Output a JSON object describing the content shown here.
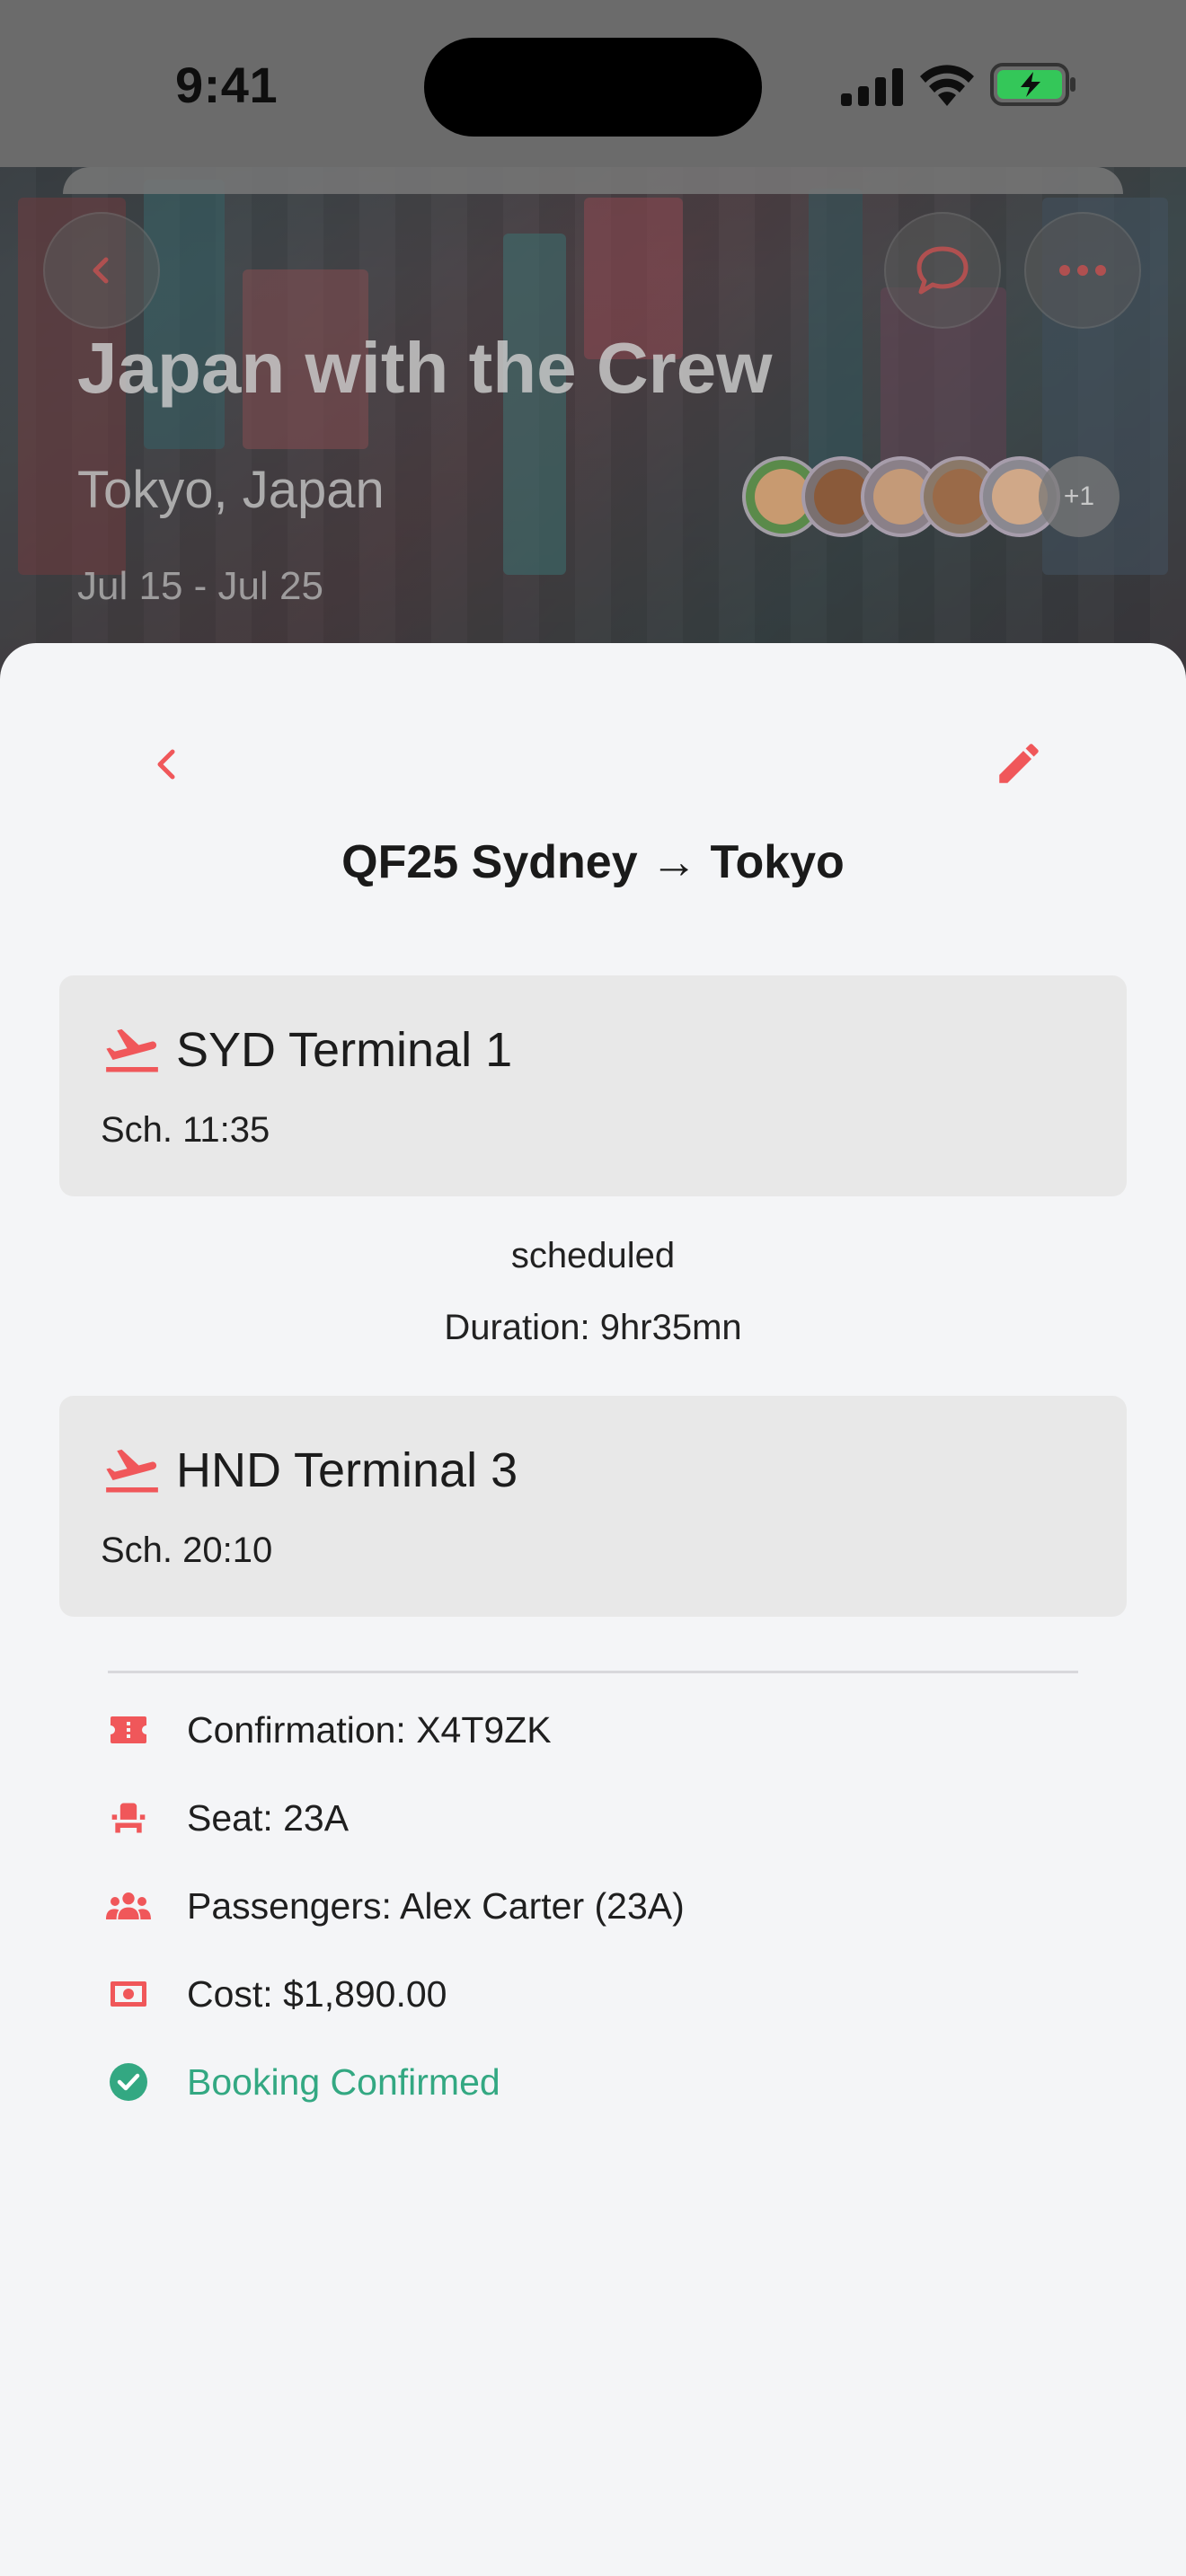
{
  "status_bar": {
    "time": "9:41"
  },
  "trip": {
    "title": "Japan with the Crew",
    "location": "Tokyo, Japan",
    "dates": "Jul 15 - Jul 25",
    "extra_members": "+1"
  },
  "flight": {
    "title": "QF25 Sydney → Tokyo",
    "departure": {
      "terminal": "SYD Terminal 1",
      "time": "Sch. 11:35"
    },
    "status": "scheduled",
    "duration": "Duration: 9hr35mn",
    "arrival": {
      "terminal": "HND Terminal 3",
      "time": "Sch. 20:10"
    }
  },
  "details": {
    "confirmation": "Confirmation: X4T9ZK",
    "seat": "Seat: 23A",
    "passengers": "Passengers: Alex Carter (23A)",
    "cost": "Cost: $1,890.00",
    "booking_status": "Booking Confirmed"
  },
  "colors": {
    "accent": "#f0575a",
    "success": "#33a882",
    "card_bg": "#e8e8e8",
    "sheet_bg": "#f4f5f7"
  },
  "icons": {
    "back": "chevron-left-icon",
    "chat": "chat-bubble-icon",
    "more": "ellipsis-icon",
    "edit": "pencil-icon",
    "departure": "flight-takeoff-icon",
    "arrival": "flight-takeoff-icon",
    "confirmation": "ticket-icon",
    "seat": "seat-icon",
    "passengers": "group-icon",
    "cost": "banknote-icon",
    "booking_status": "check-circle-icon"
  }
}
